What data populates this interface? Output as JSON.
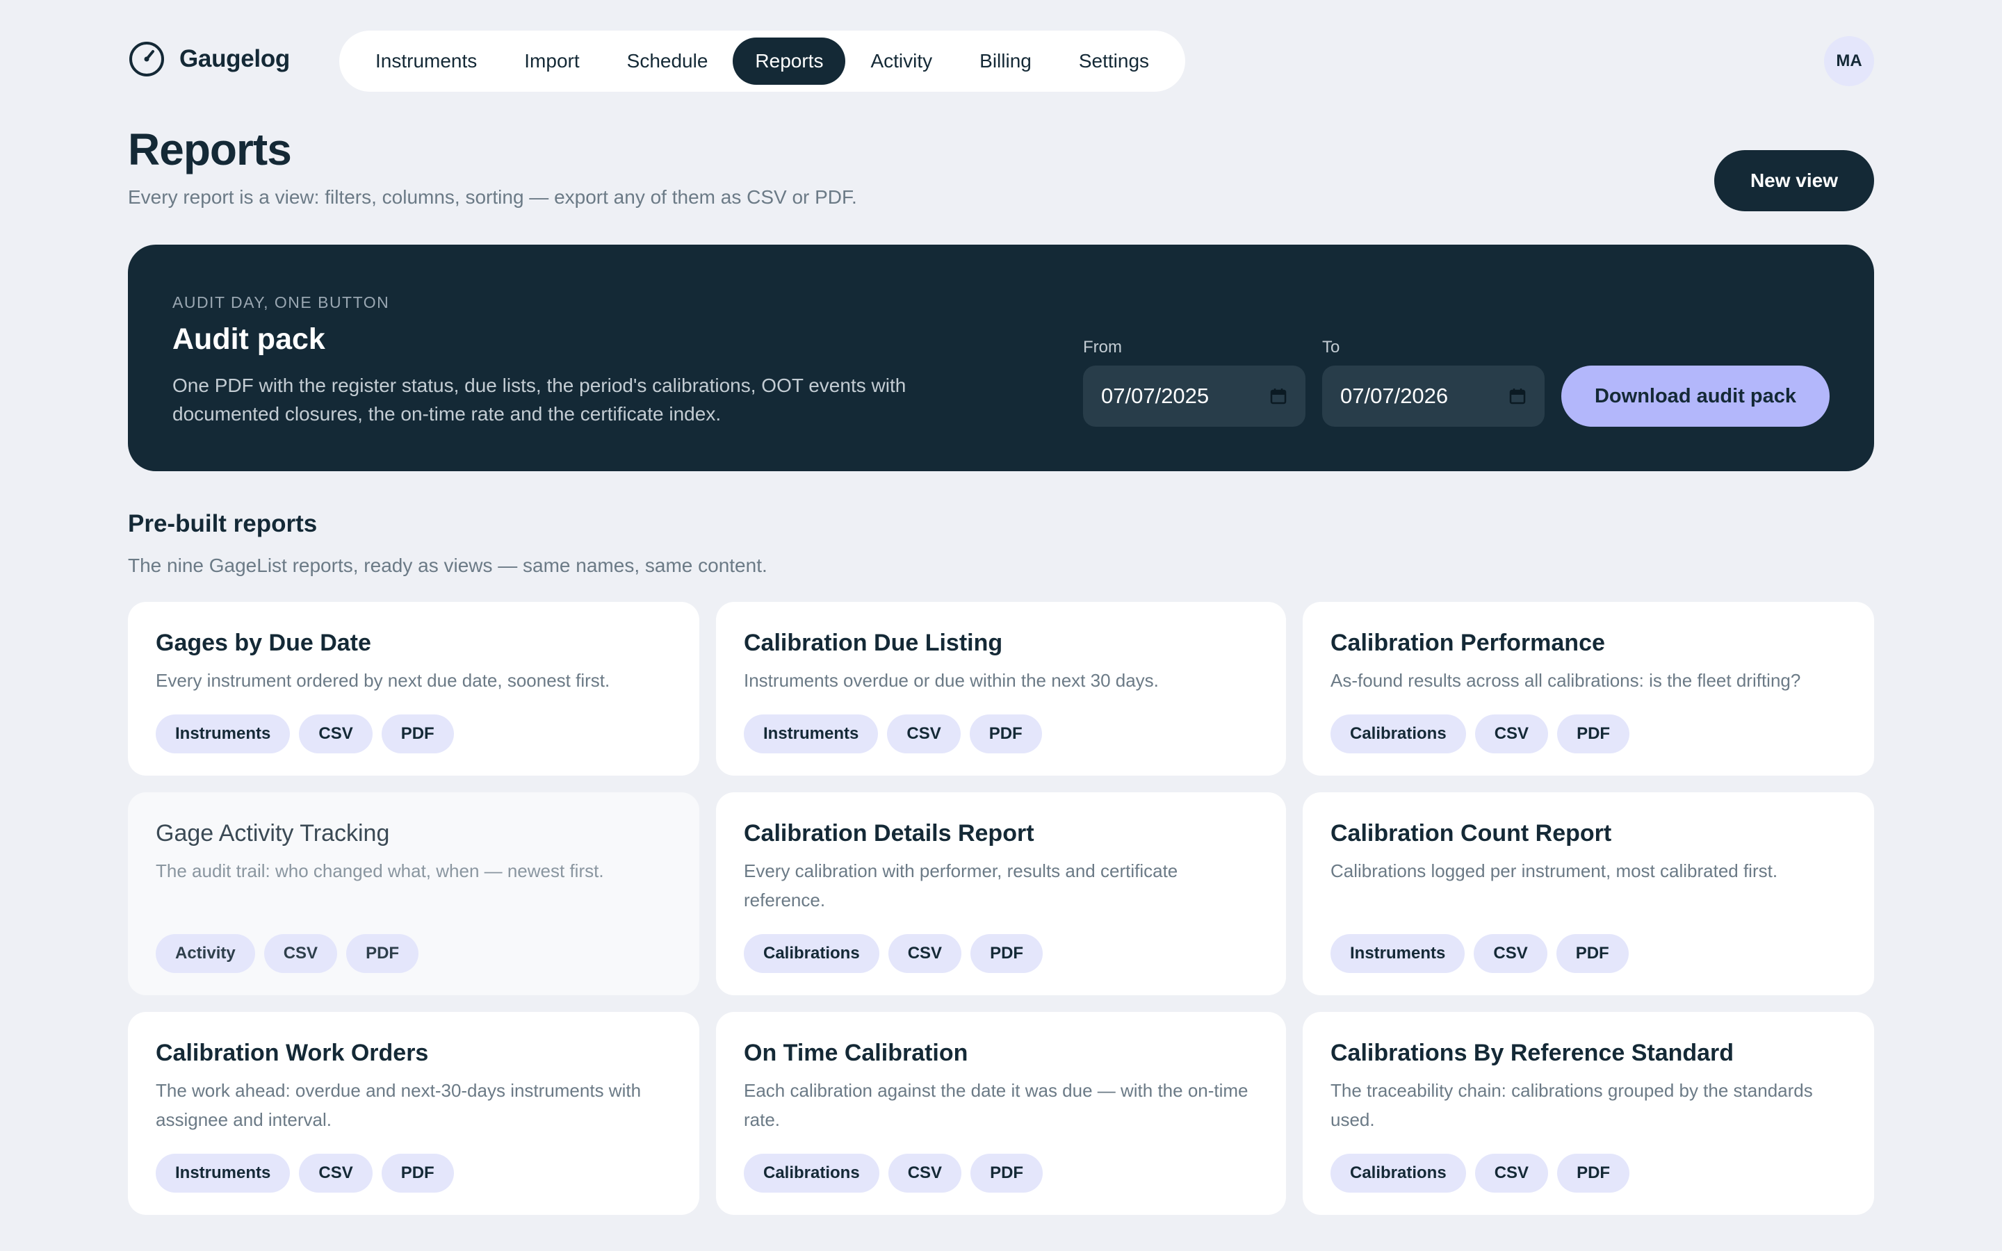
{
  "brand": {
    "name": "Gaugelog",
    "icon": "gauge-icon"
  },
  "nav": [
    {
      "label": "Instruments",
      "active": false
    },
    {
      "label": "Import",
      "active": false
    },
    {
      "label": "Schedule",
      "active": false
    },
    {
      "label": "Reports",
      "active": true
    },
    {
      "label": "Activity",
      "active": false
    },
    {
      "label": "Billing",
      "active": false
    },
    {
      "label": "Settings",
      "active": false
    }
  ],
  "user": {
    "initials": "MA"
  },
  "header": {
    "title": "Reports",
    "subtitle": "Every report is a view: filters, columns, sorting — export any of them as CSV or PDF.",
    "new_view_label": "New view"
  },
  "audit": {
    "eyebrow": "AUDIT DAY, ONE BUTTON",
    "title": "Audit pack",
    "description": "One PDF with the register status, due lists, the period's calibrations, OOT events with documented closures, the on-time rate and the certificate index.",
    "from_label": "From",
    "from_value": "07/07/2025",
    "to_label": "To",
    "to_value": "07/07/2026",
    "download_label": "Download audit pack"
  },
  "section": {
    "title": "Pre-built reports",
    "subtitle": "The nine GageList reports, ready as views — same names, same content."
  },
  "cards": [
    {
      "title": "Gages by Due Date",
      "description": "Every instrument ordered by next due date, soonest first.",
      "chips": [
        "Instruments",
        "CSV",
        "PDF"
      ]
    },
    {
      "title": "Calibration Due Listing",
      "description": "Instruments overdue or due within the next 30 days.",
      "chips": [
        "Instruments",
        "CSV",
        "PDF"
      ]
    },
    {
      "title": "Calibration Performance",
      "description": "As-found results across all calibrations: is the fleet drifting?",
      "chips": [
        "Calibrations",
        "CSV",
        "PDF"
      ]
    },
    {
      "title": "Gage Activity Tracking",
      "description": "The audit trail: who changed what, when — newest first.",
      "chips": [
        "Activity",
        "CSV",
        "PDF"
      ]
    },
    {
      "title": "Calibration Details Report",
      "description": "Every calibration with performer, results and certificate reference.",
      "chips": [
        "Calibrations",
        "CSV",
        "PDF"
      ]
    },
    {
      "title": "Calibration Count Report",
      "description": "Calibrations logged per instrument, most calibrated first.",
      "chips": [
        "Instruments",
        "CSV",
        "PDF"
      ]
    },
    {
      "title": "Calibration Work Orders",
      "description": "The work ahead: overdue and next-30-days instruments with assignee and interval.",
      "chips": [
        "Instruments",
        "CSV",
        "PDF"
      ]
    },
    {
      "title": "On Time Calibration",
      "description": "Each calibration against the date it was due — with the on-time rate.",
      "chips": [
        "Calibrations",
        "CSV",
        "PDF"
      ]
    },
    {
      "title": "Calibrations By Reference Standard",
      "description": "The traceability chain: calibrations grouped by the standards used.",
      "chips": [
        "Calibrations",
        "CSV",
        "PDF"
      ]
    }
  ],
  "colors": {
    "background": "#eef0f5",
    "primary_dark": "#142936",
    "accent": "#b3b7fb",
    "chip": "#e4e6fb"
  }
}
